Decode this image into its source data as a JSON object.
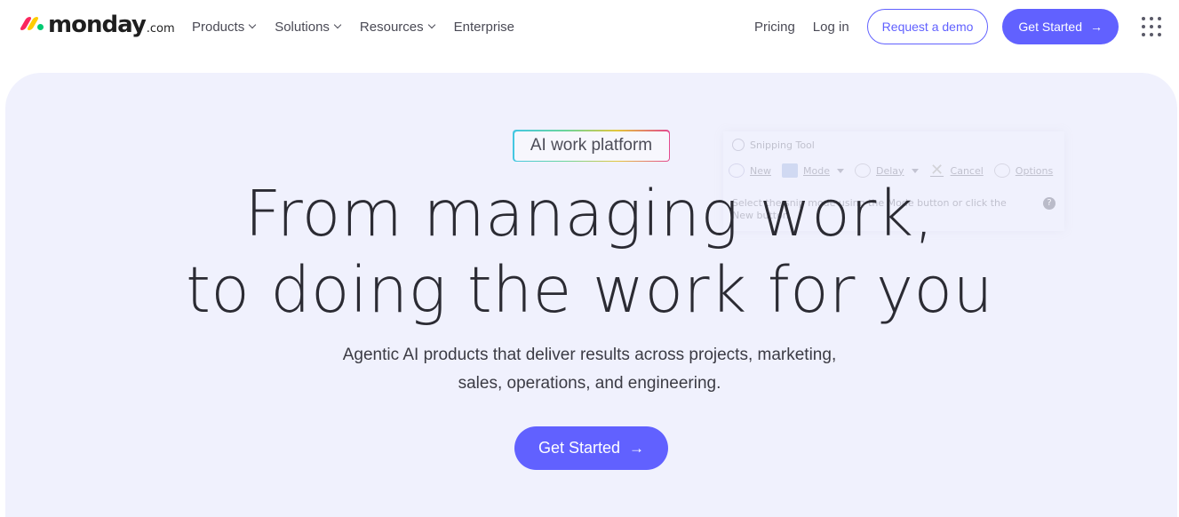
{
  "brand": {
    "wordmark": "monday",
    "suffix": ".com"
  },
  "nav": {
    "links": [
      {
        "label": "Products",
        "has_dropdown": true
      },
      {
        "label": "Solutions",
        "has_dropdown": true
      },
      {
        "label": "Resources",
        "has_dropdown": true
      },
      {
        "label": "Enterprise",
        "has_dropdown": false
      }
    ],
    "pricing": "Pricing",
    "login": "Log in",
    "demo_button": "Request a demo",
    "get_started_button": "Get Started",
    "arrow_icon": "→"
  },
  "hero": {
    "badge": "AI work platform",
    "headline_line1": "From managing work,",
    "headline_line2": "to doing the work for you",
    "sub_line1": "Agentic AI products that deliver results across projects, marketing,",
    "sub_line2": "sales, operations, and engineering.",
    "cta": "Get Started"
  },
  "snipping_tool": {
    "title": "Snipping Tool",
    "new": "New",
    "mode": "Mode",
    "delay": "Delay",
    "cancel": "Cancel",
    "options": "Options",
    "message": "Select the snip mode using the Mode button or click the New button.",
    "help": "?"
  },
  "colors": {
    "accent": "#6161ff",
    "hero_bg": "#f0f1fd",
    "text": "#323338"
  },
  "icons": [
    "chevron-down-icon",
    "arrow-right-icon",
    "apps-grid-icon",
    "scissors-icon"
  ]
}
